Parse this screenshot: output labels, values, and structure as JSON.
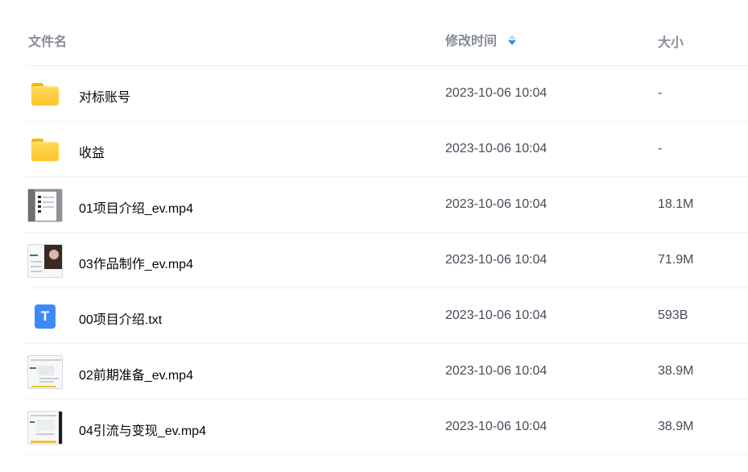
{
  "header": {
    "name_label": "文件名",
    "time_label": "修改时间",
    "size_label": "大小"
  },
  "colors": {
    "header_text": "#878c9c",
    "sort_active": "#2f8ff2",
    "folder": "#fcc52b",
    "txt_icon": "#3d8af7"
  },
  "files": [
    {
      "name": "对标账号",
      "time": "2023-10-06 10:04",
      "size": "-",
      "icon": "folder-icon"
    },
    {
      "name": "收益",
      "time": "2023-10-06 10:04",
      "size": "-",
      "icon": "folder-icon"
    },
    {
      "name": "01项目介绍_ev.mp4",
      "time": "2023-10-06 10:04",
      "size": "18.1M",
      "icon": "video-thumbnail-icon"
    },
    {
      "name": "03作品制作_ev.mp4",
      "time": "2023-10-06 10:04",
      "size": "71.9M",
      "icon": "video-thumbnail-icon"
    },
    {
      "name": "00项目介绍.txt",
      "time": "2023-10-06 10:04",
      "size": "593B",
      "icon": "text-file-icon",
      "icon_letter": "T"
    },
    {
      "name": "02前期准备_ev.mp4",
      "time": "2023-10-06 10:04",
      "size": "38.9M",
      "icon": "video-thumbnail-icon"
    },
    {
      "name": "04引流与变现_ev.mp4",
      "time": "2023-10-06 10:04",
      "size": "38.9M",
      "icon": "video-thumbnail-icon"
    }
  ]
}
